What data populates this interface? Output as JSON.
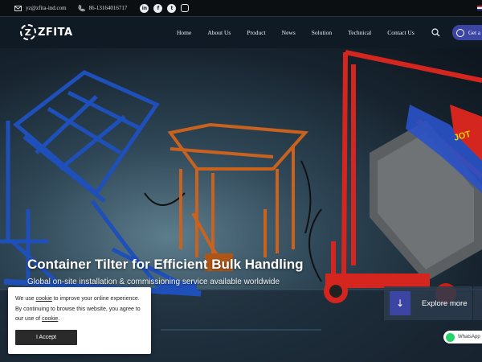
{
  "topbar": {
    "email": "yz@zfita-ind.com",
    "phone": "86-13164016717",
    "social": [
      {
        "icon": "linkedin-icon",
        "glyph": "in"
      },
      {
        "icon": "facebook-icon",
        "glyph": "f"
      },
      {
        "icon": "twitter-icon",
        "glyph": "t"
      },
      {
        "icon": "instagram-icon",
        "glyph": "◎"
      }
    ]
  },
  "nav": {
    "logo": "ZFITA",
    "logo_letter": "Z",
    "items": [
      "Home",
      "About Us",
      "Product",
      "News",
      "Solution",
      "Technical",
      "Contact Us"
    ],
    "cta_label": "Get a"
  },
  "hero": {
    "title": "Container Tilter for Efficient Bulk Handling",
    "subtitle": "Global on-site installation & commissioning service available worldwide",
    "explore_label": "Explore more",
    "machine_label": "JOT"
  },
  "cookie": {
    "text_1": "We use ",
    "link_1": "cookie",
    "text_2": " to improve your online experience. By continuing to browse this website, you agree to our use of ",
    "link_2": "cookie",
    "text_3": ".",
    "accept_label": "I Accept"
  },
  "whatsapp": {
    "label": "WhatsApp"
  },
  "colors": {
    "accent": "#3c45a3",
    "blue_machine": "#1f4fb8",
    "orange_machine": "#c9621f",
    "red_machine": "#d4261e"
  }
}
